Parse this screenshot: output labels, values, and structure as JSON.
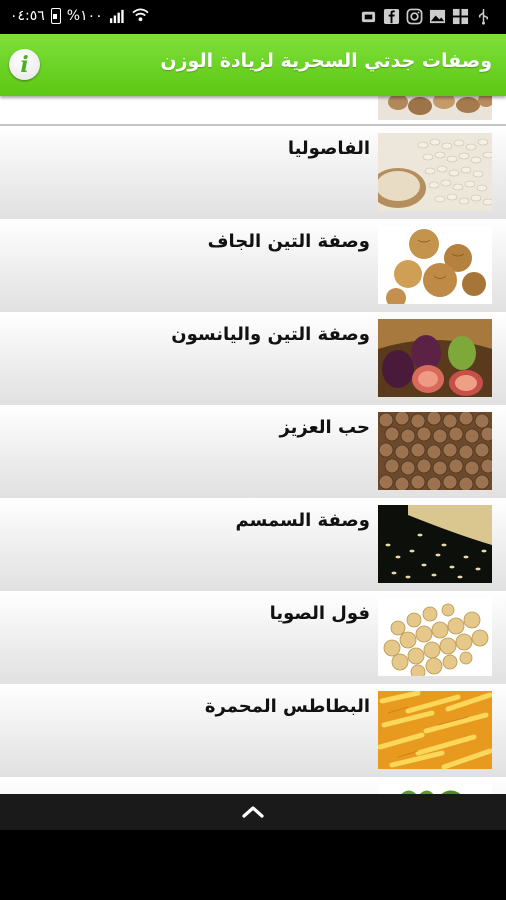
{
  "status_bar": {
    "time": "٠٤:٥٦",
    "battery": "%١٠٠"
  },
  "app_bar": {
    "title": "وصفات جدتي السحرية لزيادة الوزن"
  },
  "recipes": [
    {
      "name": "الفاصوليا",
      "image": "white-beans"
    },
    {
      "name": "وصفة التين الجاف",
      "image": "dried-figs"
    },
    {
      "name": "وصفة التين واليانسون",
      "image": "fresh-figs"
    },
    {
      "name": "حب العزيز",
      "image": "tiger-nuts"
    },
    {
      "name": "وصفة السمسم",
      "image": "sesame-seeds"
    },
    {
      "name": "فول الصويا",
      "image": "soybeans"
    },
    {
      "name": "البطاطس المحمرة",
      "image": "french-fries"
    }
  ]
}
